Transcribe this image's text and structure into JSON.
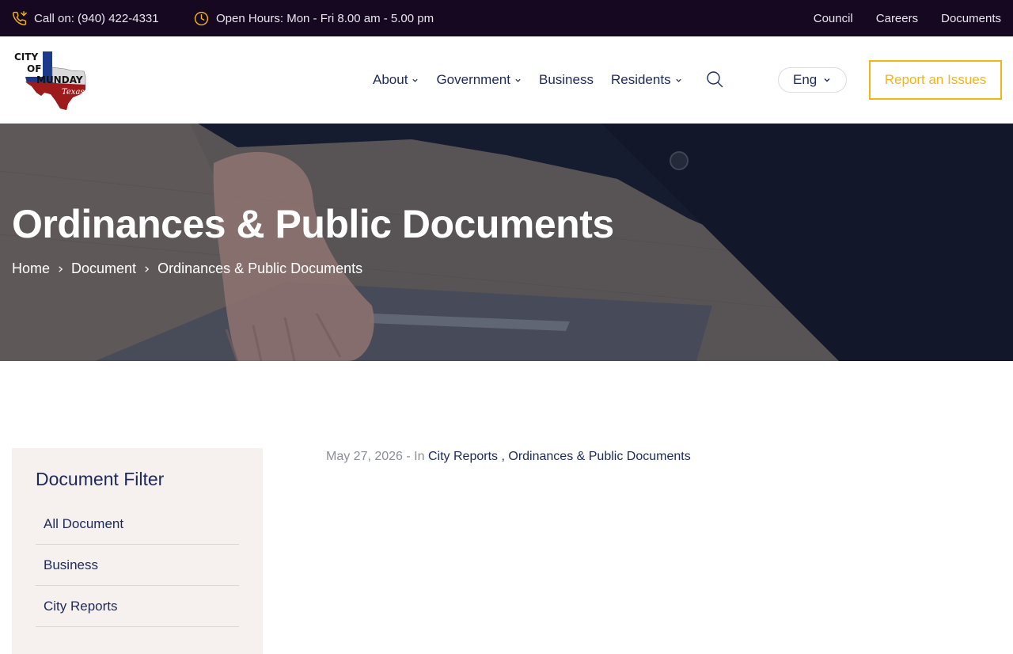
{
  "topbar": {
    "phone": "Call on: (940) 422-4331",
    "hours": "Open Hours: Mon - Fri 8.00 am - 5.00 pm",
    "links": [
      "Council",
      "Careers",
      "Documents"
    ],
    "accent": "#f2b515"
  },
  "logo": {
    "line1": "CITY",
    "line2": "OF",
    "line3": "MUNDAY",
    "script": "Texas"
  },
  "nav": {
    "items": [
      {
        "label": "About",
        "dropdown": true
      },
      {
        "label": "Government",
        "dropdown": true
      },
      {
        "label": "Business",
        "dropdown": false
      },
      {
        "label": "Residents",
        "dropdown": true
      }
    ],
    "language": "Eng",
    "report_button": "Report an Issues"
  },
  "hero": {
    "title": "Ordinances & Public Documents",
    "breadcrumb": [
      "Home",
      "Document",
      "Ordinances & Public Documents"
    ]
  },
  "sidebar": {
    "title": "Document Filter",
    "items": [
      "All Document",
      "Business",
      "City Reports"
    ]
  },
  "post": {
    "date": "May 27, 2026",
    "in_label": "- In",
    "categories": [
      "City Reports",
      "Ordinances & Public Documents"
    ],
    "separator": ","
  },
  "colors": {
    "topbar_bg": "#170822",
    "navy": "#1c2a5a",
    "accent": "#f2b515",
    "sidebar_bg": "#f6f0ee"
  }
}
